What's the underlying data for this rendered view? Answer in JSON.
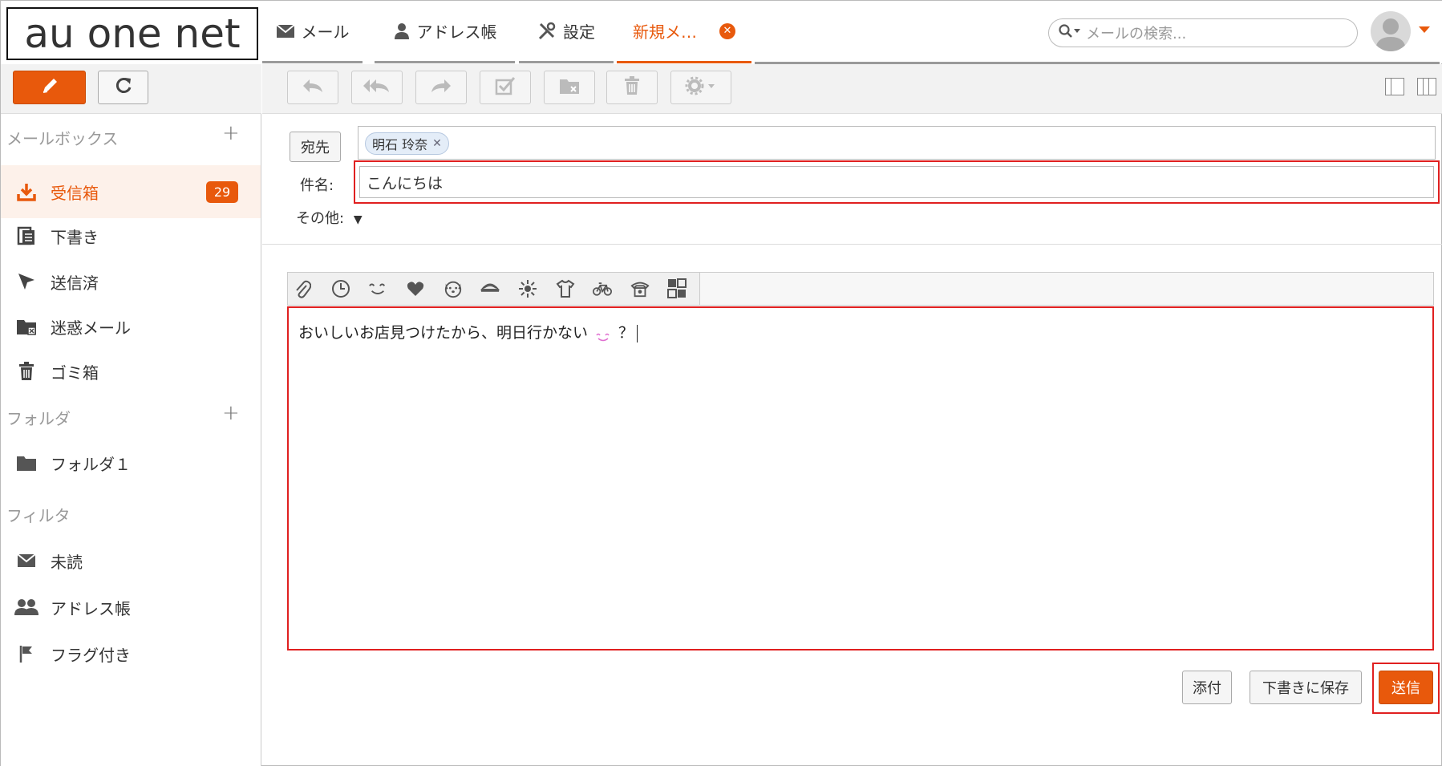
{
  "header": {
    "logo_text": "au one net",
    "tabs": [
      {
        "label": "メール",
        "icon": "mail-icon"
      },
      {
        "label": "アドレス帳",
        "icon": "person-icon"
      },
      {
        "label": "設定",
        "icon": "tools-icon"
      },
      {
        "label": "新規メ…",
        "icon": "",
        "active": true
      }
    ],
    "search_placeholder": "メールの検索...",
    "accent_color": "#e8590c"
  },
  "sidebar": {
    "mailbox_title": "メールボックス",
    "mailboxes": [
      {
        "label": "受信箱",
        "icon": "inbox-download-icon",
        "count": "29",
        "active": true
      },
      {
        "label": "下書き",
        "icon": "drafts-icon"
      },
      {
        "label": "送信済",
        "icon": "sent-icon"
      },
      {
        "label": "迷惑メール",
        "icon": "spam-icon"
      },
      {
        "label": "ゴミ箱",
        "icon": "trash-icon"
      }
    ],
    "folder_title": "フォルダ",
    "folders": [
      {
        "label": "フォルダ１",
        "icon": "folder-icon"
      }
    ],
    "filter_title": "フィルタ",
    "filters": [
      {
        "label": "未読",
        "icon": "envelope-icon"
      },
      {
        "label": "アドレス帳",
        "icon": "people-icon"
      },
      {
        "label": "フラグ付き",
        "icon": "flag-icon"
      }
    ]
  },
  "compose": {
    "to_label": "宛先",
    "recipient": "明石 玲奈",
    "subject_label": "件名:",
    "subject_value": "こんにちは",
    "other_label": "その他:",
    "body_text_before": "おいしいお店見つけたから、明日行かない",
    "body_text_after": "？"
  },
  "footer": {
    "attach_label": "添付",
    "save_draft_label": "下書きに保存",
    "send_label": "送信"
  }
}
